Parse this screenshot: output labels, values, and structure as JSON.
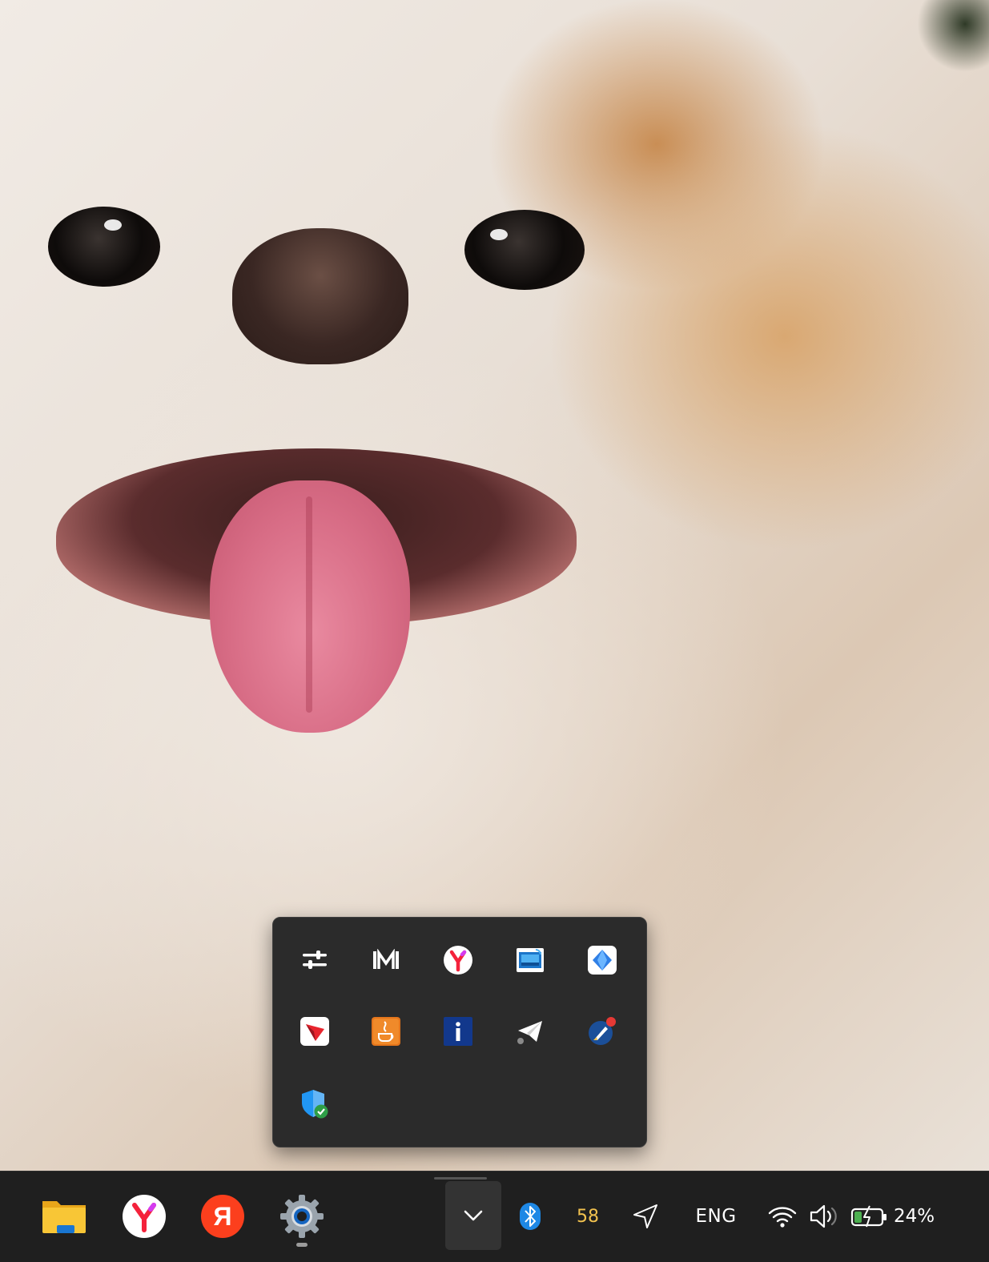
{
  "desktop": {
    "wallpaper": "pomeranian-dog-photo"
  },
  "tray_overflow": {
    "icons": [
      {
        "name": "sliders-icon"
      },
      {
        "name": "m-logo-icon"
      },
      {
        "name": "yandex-browser-icon"
      },
      {
        "name": "remote-display-icon"
      },
      {
        "name": "diamond-app-icon"
      },
      {
        "name": "red-arrow-app-icon"
      },
      {
        "name": "java-icon"
      },
      {
        "name": "info-app-icon"
      },
      {
        "name": "telegram-icon"
      },
      {
        "name": "rocket-notification-icon"
      },
      {
        "name": "security-shield-icon"
      }
    ]
  },
  "taskbar": {
    "pinned_apps": [
      {
        "name": "file-explorer-icon"
      },
      {
        "name": "yandex-browser-icon"
      },
      {
        "name": "yandex-icon",
        "glyph": "Я"
      },
      {
        "name": "settings-gear-icon"
      }
    ],
    "system_tray": {
      "temperature": "58",
      "language": "ENG",
      "battery_percent": "24%"
    }
  },
  "colors": {
    "taskbar_bg": "#1f1f1f",
    "flyout_bg": "#2b2b2b",
    "temperature_text": "#f2c24f",
    "bluetooth_blue": "#1e88e5"
  }
}
